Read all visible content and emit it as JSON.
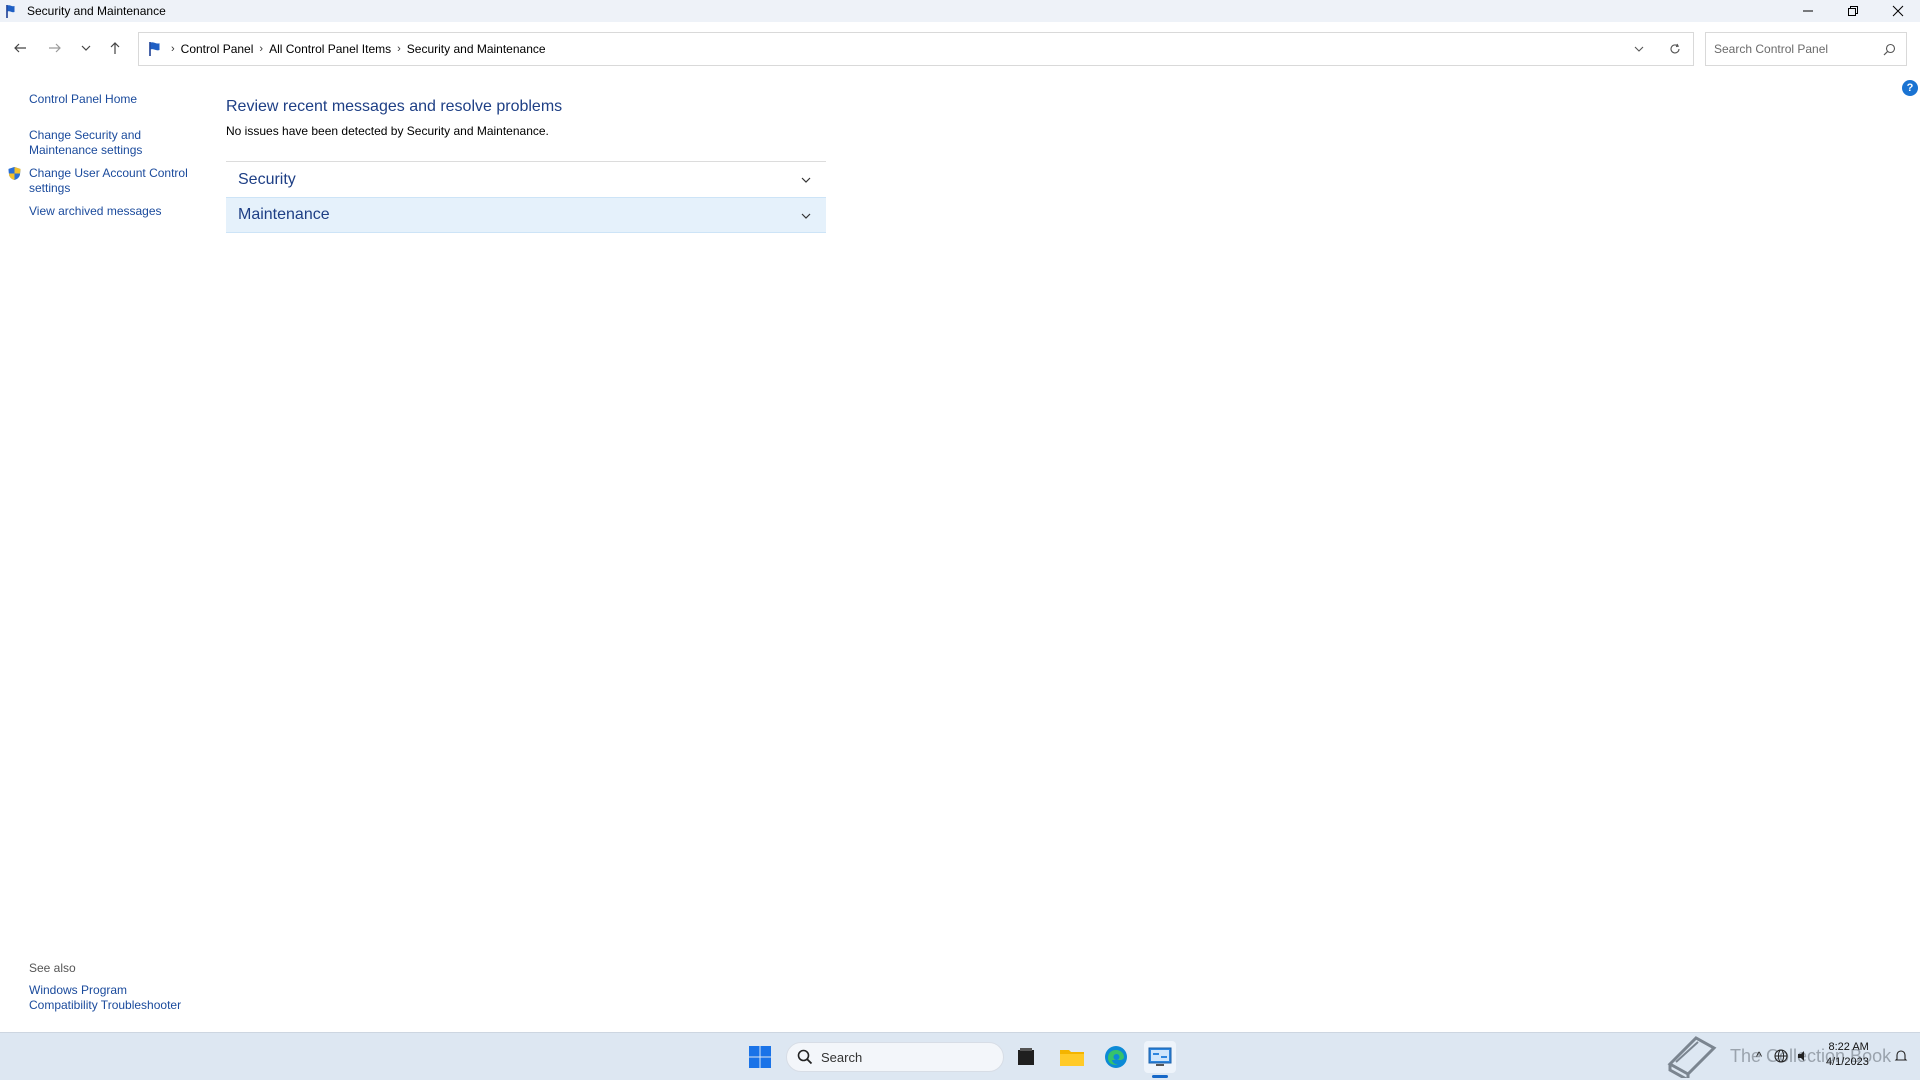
{
  "window": {
    "title": "Security and Maintenance"
  },
  "address": {
    "breadcrumbs": [
      "Control Panel",
      "All Control Panel Items",
      "Security and Maintenance"
    ],
    "search_placeholder": "Search Control Panel"
  },
  "left_pane": {
    "links": {
      "home": "Control Panel Home",
      "change_settings": "Change Security and Maintenance settings",
      "change_uac": "Change User Account Control settings",
      "archived": "View archived messages"
    },
    "see_also_heading": "See also",
    "see_also_link": "Windows Program Compatibility Troubleshooter"
  },
  "main": {
    "title": "Review recent messages and resolve problems",
    "subtitle": "No issues have been detected by Security and Maintenance.",
    "sections": {
      "security": "Security",
      "maintenance": "Maintenance"
    }
  },
  "taskbar": {
    "search_label": "Search",
    "watermark": "The Collection Book",
    "time": "8:22 AM",
    "date": "4/1/2023"
  },
  "colors": {
    "accent_blue": "#1e3f85",
    "link_blue": "#1a4a9c",
    "selected_row": "#e5f1fb"
  }
}
